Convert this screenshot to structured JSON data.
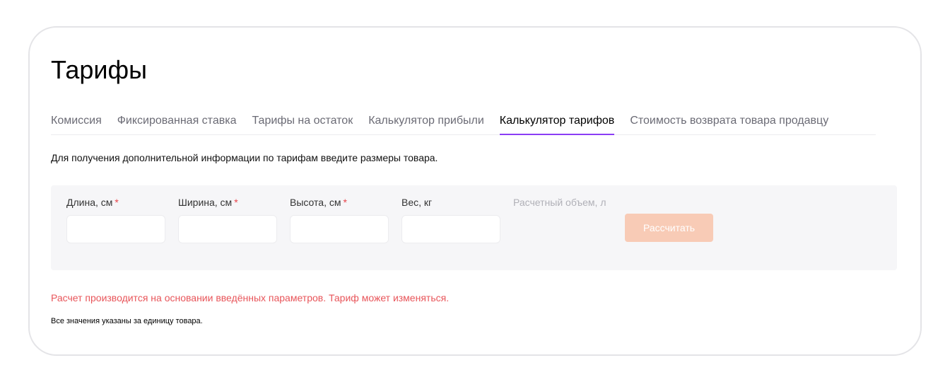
{
  "page": {
    "title": "Тарифы"
  },
  "tabs": [
    {
      "label": "Комиссия",
      "active": false
    },
    {
      "label": "Фиксированная ставка",
      "active": false
    },
    {
      "label": "Тарифы на остаток",
      "active": false
    },
    {
      "label": "Калькулятор прибыли",
      "active": false
    },
    {
      "label": "Калькулятор тарифов",
      "active": true
    },
    {
      "label": "Стоимость возврата товара продавцу",
      "active": false
    }
  ],
  "info_text": "Для получения дополнительной информации по тарифам введите размеры товара.",
  "form": {
    "fields": [
      {
        "label": "Длина, см",
        "required": true,
        "value": ""
      },
      {
        "label": "Ширина, см",
        "required": true,
        "value": ""
      },
      {
        "label": "Высота, см",
        "required": true,
        "value": ""
      },
      {
        "label": "Вес, кг",
        "required": false,
        "value": ""
      }
    ],
    "required_mark": "*",
    "volume_label": "Расчетный объем, л",
    "calculate_button": "Рассчитать"
  },
  "warning_text": "Расчет производится на основании введённых параметров. Тариф может изменяться.",
  "note_text": "Все значения указаны за единицу товара.",
  "colors": {
    "accent_tab_underline": "#8b3df5",
    "required_mark": "#e8454b",
    "warning": "#e8555a",
    "button_disabled_bg": "#f8cbb6"
  }
}
